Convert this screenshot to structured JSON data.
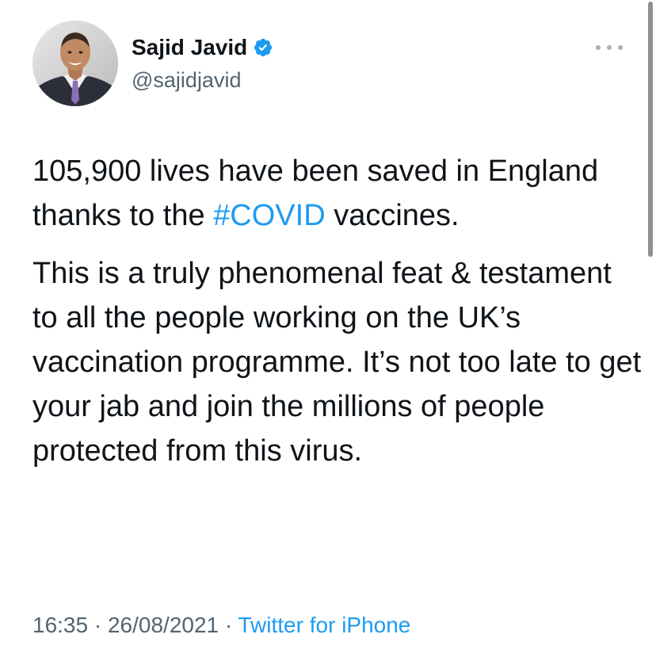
{
  "author": {
    "display_name": "Sajid Javid",
    "handle": "@sajidjavid",
    "verified": true,
    "avatar_icon": "user-avatar-photo"
  },
  "tweet": {
    "paragraph1_before": "105,900 lives have been saved in England thanks to the ",
    "hashtag": "#COVID",
    "paragraph1_after": " vaccines.",
    "paragraph2": "This is a truly phenomenal feat & testament to all the people working on the UK’s vaccination programme. It’s not too late to get your jab and join the millions of people protected from this virus."
  },
  "meta": {
    "time": "16:35",
    "separator": " · ",
    "date": "26/08/2021",
    "source": "Twitter for iPhone"
  },
  "icons": {
    "verified": "verified-badge-icon",
    "more": "more-options-icon"
  },
  "colors": {
    "text": "#0f1419",
    "secondary": "#536471",
    "link": "#1d9bf0",
    "verified": "#1d9bf0"
  }
}
